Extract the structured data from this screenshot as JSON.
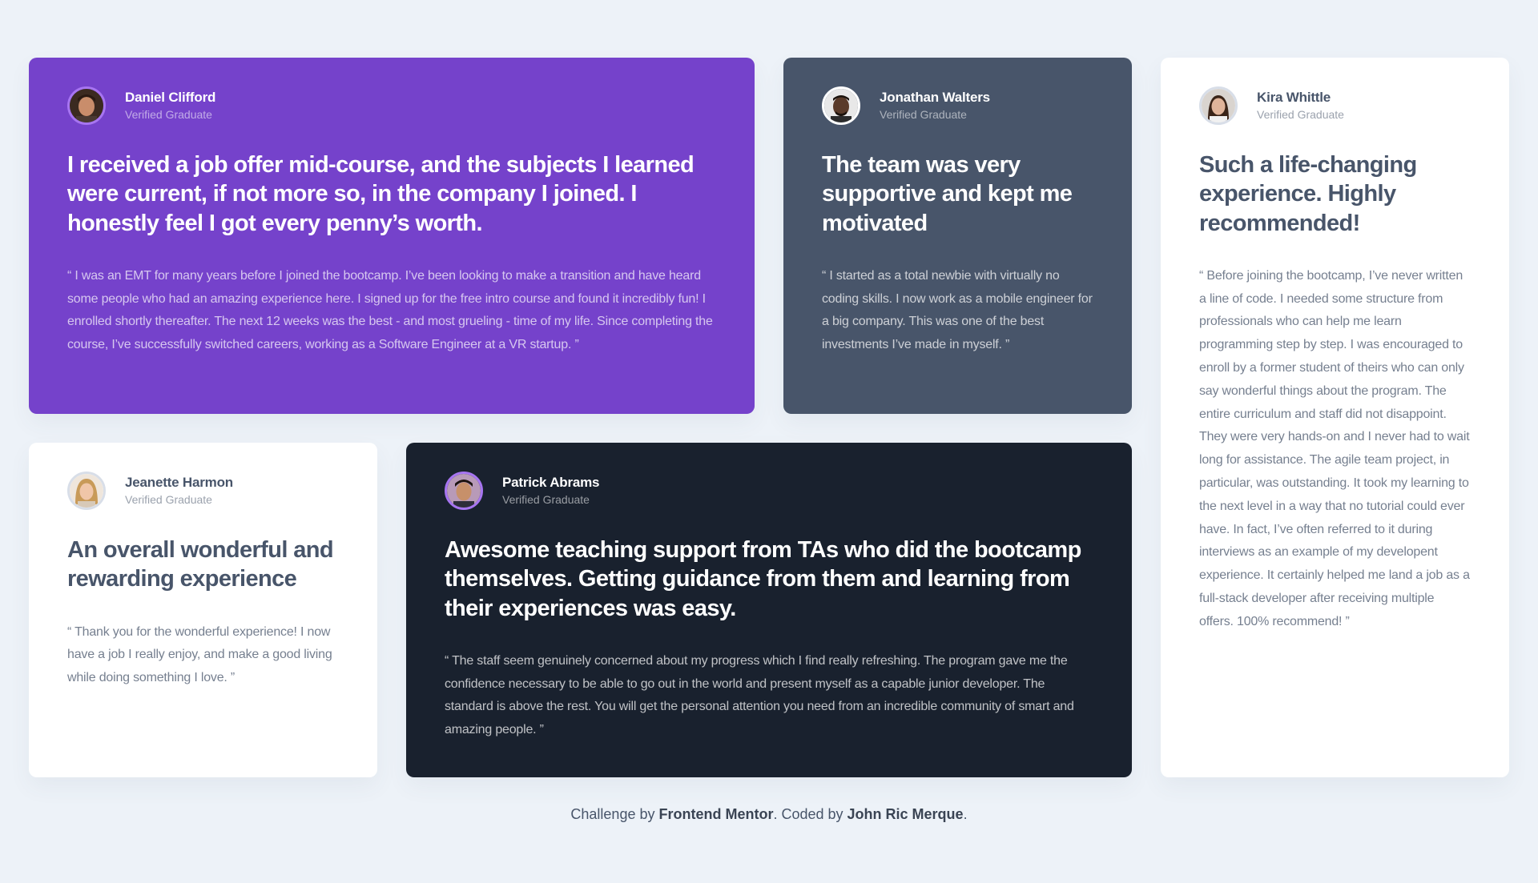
{
  "theme": {
    "background": "#edf2f8",
    "purple": "#7542cb",
    "slate": "#48556a",
    "dark": "#19212e",
    "white": "#ffffff",
    "avatar_ring_accent": "#a775f1"
  },
  "testimonials": [
    {
      "name": "Daniel Clifford",
      "role": "Verified Graduate",
      "avatar_icon": "daniel-avatar",
      "headline": "I received a job offer mid-course, and the subjects I learned were current, if not more so, in the company I joined. I honestly feel I got every penny’s worth.",
      "quote": "“ I was an EMT for many years before I joined the bootcamp. I’ve been looking to make a transition and have heard some people who had an amazing experience here. I signed up for the free intro course and found it incredibly fun! I enrolled shortly thereafter. The next 12 weeks was the best - and most grueling - time of my life. Since completing the course, I’ve successfully switched careers, working as a Software Engineer at a VR startup. ”"
    },
    {
      "name": "Jonathan Walters",
      "role": "Verified Graduate",
      "avatar_icon": "jonathan-avatar",
      "headline": "The team was very supportive and kept me motivated",
      "quote": "“ I started as a total newbie with virtually no coding skills. I now work as a mobile engineer for a big company. This was one of the best investments I’ve made in myself. ”"
    },
    {
      "name": "Kira Whittle",
      "role": "Verified Graduate",
      "avatar_icon": "kira-avatar",
      "headline": "Such a life-changing experience. Highly recommended!",
      "quote": "“ Before joining the bootcamp, I’ve never written a line of code. I needed some structure from professionals who can help me learn programming step by step. I was encouraged to enroll by a former student of theirs who can only say wonderful things about the program. The entire curriculum and staff did not disappoint. They were very hands-on and I never had to wait long for assistance. The agile team project, in particular, was outstanding. It took my learning to the next level in a way that no tutorial could ever have. In fact, I’ve often referred to it during interviews as an example of my developent experience. It certainly helped me land a job as a full-stack developer after receiving multiple offers. 100% recommend! ”"
    },
    {
      "name": "Jeanette Harmon",
      "role": "Verified Graduate",
      "avatar_icon": "jeanette-avatar",
      "headline": "An overall wonderful and rewarding experience",
      "quote": "“ Thank you for the wonderful experience! I now have a job I really enjoy, and make a good living while doing something I love. ”"
    },
    {
      "name": "Patrick Abrams",
      "role": "Verified Graduate",
      "avatar_icon": "patrick-avatar",
      "headline": "Awesome teaching support from TAs who did the bootcamp themselves. Getting guidance from them and learning from their experiences was easy.",
      "quote": "“ The staff seem genuinely concerned about my progress which I find really refreshing. The program gave me the confidence necessary to be able to go out in the world and present myself as a capable junior developer. The standard is above the rest. You will get the personal attention you need from an incredible community of smart and amazing people. ”"
    }
  ],
  "footer": {
    "prefix": "Challenge by ",
    "challenge_link": "Frontend Mentor",
    "middle": ". Coded by ",
    "author_link": "John Ric Merque",
    "suffix": "."
  }
}
